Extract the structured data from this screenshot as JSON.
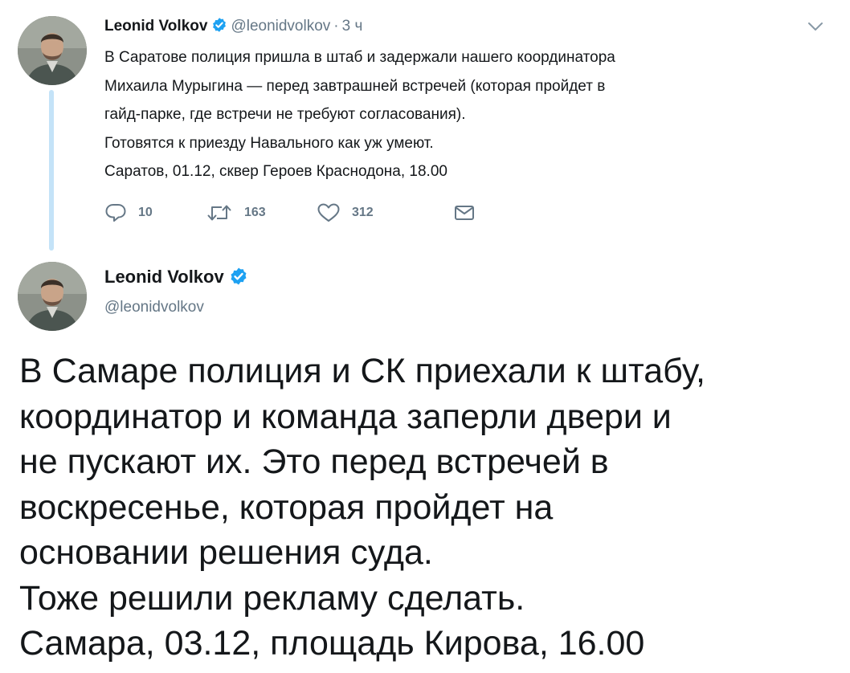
{
  "parent_tweet": {
    "author_name": "Leonid Volkov",
    "handle": "@leonidvolkov",
    "separator": "·",
    "time": "3 ч",
    "text_lines": [
      "В Саратове полиция пришла в штаб и задержали нашего координатора",
      "Михаила Мурыгина — перед завтрашней встречей (которая пройдет в",
      "гайд-парке, где встречи не требуют согласования).",
      "Готовятся к приезду Навального как уж умеют.",
      "Саратов, 01.12, сквер Героев Краснодона, 18.00"
    ],
    "reply_count": "10",
    "retweet_count": "163",
    "like_count": "312"
  },
  "main_tweet": {
    "author_name": "Leonid Volkov",
    "handle": "@leonidvolkov",
    "text_lines": [
      "В Самаре полиция и СК приехали к штабу,",
      "координатор и команда заперли двери и",
      "не пускают их. Это перед встречей в",
      "воскресенье, которая пройдет на",
      "основании решения суда.",
      "Тоже решили рекламу сделать.",
      "Самара, 03.12, площадь Кирова, 16.00"
    ]
  },
  "icons": {
    "verified": "verified-badge-icon",
    "caret": "chevron-down-icon",
    "reply": "reply-icon",
    "retweet": "retweet-icon",
    "like": "heart-icon",
    "dm": "envelope-icon"
  },
  "colors": {
    "verified": "#1da1f2",
    "thread_line": "#c4e3f8",
    "secondary_text": "#657786",
    "primary_text": "#14171a"
  }
}
